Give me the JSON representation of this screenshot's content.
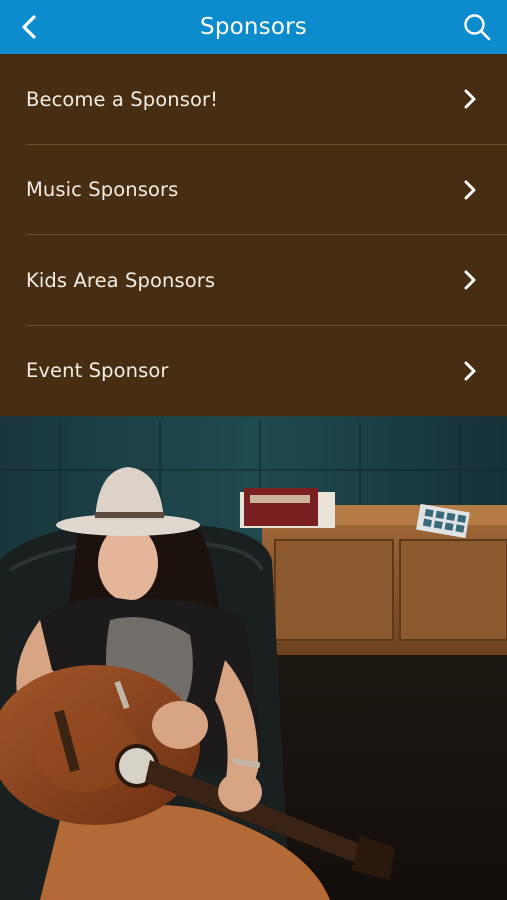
{
  "header": {
    "title": "Sponsors",
    "back_icon": "chevron-left-icon",
    "search_icon": "search-icon",
    "background_color": "#0d8ccd"
  },
  "menu": {
    "background_color": "#472e12",
    "items": [
      {
        "label": "Become a Sponsor!",
        "icon": "chevron-right-icon"
      },
      {
        "label": "Music Sponsors",
        "icon": "chevron-right-icon"
      },
      {
        "label": "Kids Area Sponsors",
        "icon": "chevron-right-icon"
      },
      {
        "label": "Event Sponsor",
        "icon": "chevron-right-icon"
      }
    ]
  },
  "background": {
    "image": "photo-woman-with-guitar"
  }
}
